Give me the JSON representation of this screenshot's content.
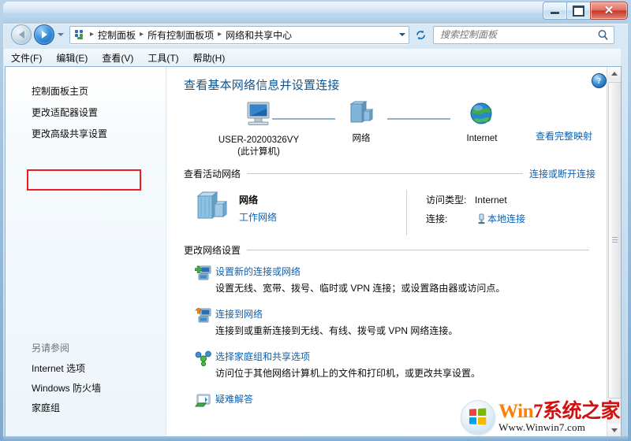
{
  "window": {
    "controls": {
      "minimize": "−",
      "maximize": "□",
      "close": "✕"
    }
  },
  "addressbar": {
    "back_tooltip": "后退",
    "forward_tooltip": "前进",
    "breadcrumbs": [
      "控制面板",
      "所有控制面板项",
      "网络和共享中心"
    ],
    "separator": "▸",
    "refresh_glyph": "↻"
  },
  "search": {
    "placeholder": "搜索控制面板",
    "value": ""
  },
  "menubar": {
    "items": [
      "文件(F)",
      "编辑(E)",
      "查看(V)",
      "工具(T)",
      "帮助(H)"
    ]
  },
  "sidebar": {
    "links": [
      "控制面板主页",
      "更改适配器设置",
      "更改高级共享设置"
    ],
    "highlighted_index": 1,
    "highlight_color": "#ec1c24",
    "see_also": {
      "title": "另请参阅",
      "links": [
        "Internet 选项",
        "Windows 防火墙",
        "家庭组"
      ]
    }
  },
  "main": {
    "help_glyph": "?",
    "page_title": "查看基本网络信息并设置连接",
    "network_map": {
      "nodes": [
        {
          "label": "USER-20200326VY",
          "sublabel": "(此计算机)",
          "icon": "computer-icon"
        },
        {
          "label": "网络",
          "sublabel": "",
          "icon": "network-icon"
        },
        {
          "label": "Internet",
          "sublabel": "",
          "icon": "globe-icon"
        }
      ],
      "full_map_link": "查看完整映射"
    },
    "active_networks": {
      "section_title": "查看活动网络",
      "section_link": "连接或断开连接",
      "network_name": "网络",
      "network_type": "工作网络",
      "details": [
        {
          "key": "访问类型:",
          "value": "Internet",
          "is_link": false
        },
        {
          "key": "连接:",
          "value": "本地连接",
          "is_link": true
        }
      ]
    },
    "change_settings": {
      "section_title": "更改网络设置",
      "options": [
        {
          "icon": "new-connection-icon",
          "title": "设置新的连接或网络",
          "desc": "设置无线、宽带、拨号、临时或 VPN 连接；或设置路由器或访问点。"
        },
        {
          "icon": "connect-network-icon",
          "title": "连接到网络",
          "desc": "连接到或重新连接到无线、有线、拨号或 VPN 网络连接。"
        },
        {
          "icon": "homegroup-icon",
          "title": "选择家庭组和共享选项",
          "desc": "访问位于其他网络计算机上的文件和打印机，或更改共享设置。"
        },
        {
          "icon": "troubleshoot-icon",
          "title": "疑难解答",
          "desc": ""
        }
      ]
    }
  },
  "scrollbar": {
    "up_arrow": "▲",
    "down_arrow": "▼"
  },
  "watermark": {
    "title_part1": "Win",
    "title_part2": "7",
    "title_part3": "系统之家",
    "url": "Www.Winwin7.com"
  }
}
